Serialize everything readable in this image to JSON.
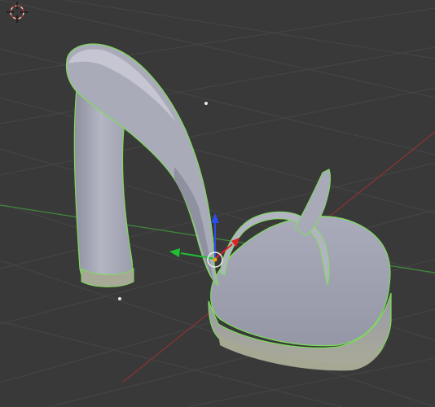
{
  "viewport": {
    "background": "#393939",
    "grid_color": "#464646",
    "x_axis_color": "#8a3434",
    "y_axis_color": "#3f8a3a"
  },
  "object": {
    "name": "high-heel-sandal",
    "body_color": "#a5a7b6",
    "highlight_color": "#c7c8d4",
    "shadow_color": "#8b8c9c",
    "selection_outline_color": "#7ddd5a",
    "underside_color": "#a4a591"
  },
  "gizmo": {
    "z_arrow_color": "#2c4cf0",
    "y_arrow_color": "#1fbf33",
    "x_arrow_color": "#dd2323"
  },
  "icons": {
    "cursor": "3d-cursor-icon",
    "lamp": "lamp-icon",
    "origin": "object-origin-icon"
  }
}
